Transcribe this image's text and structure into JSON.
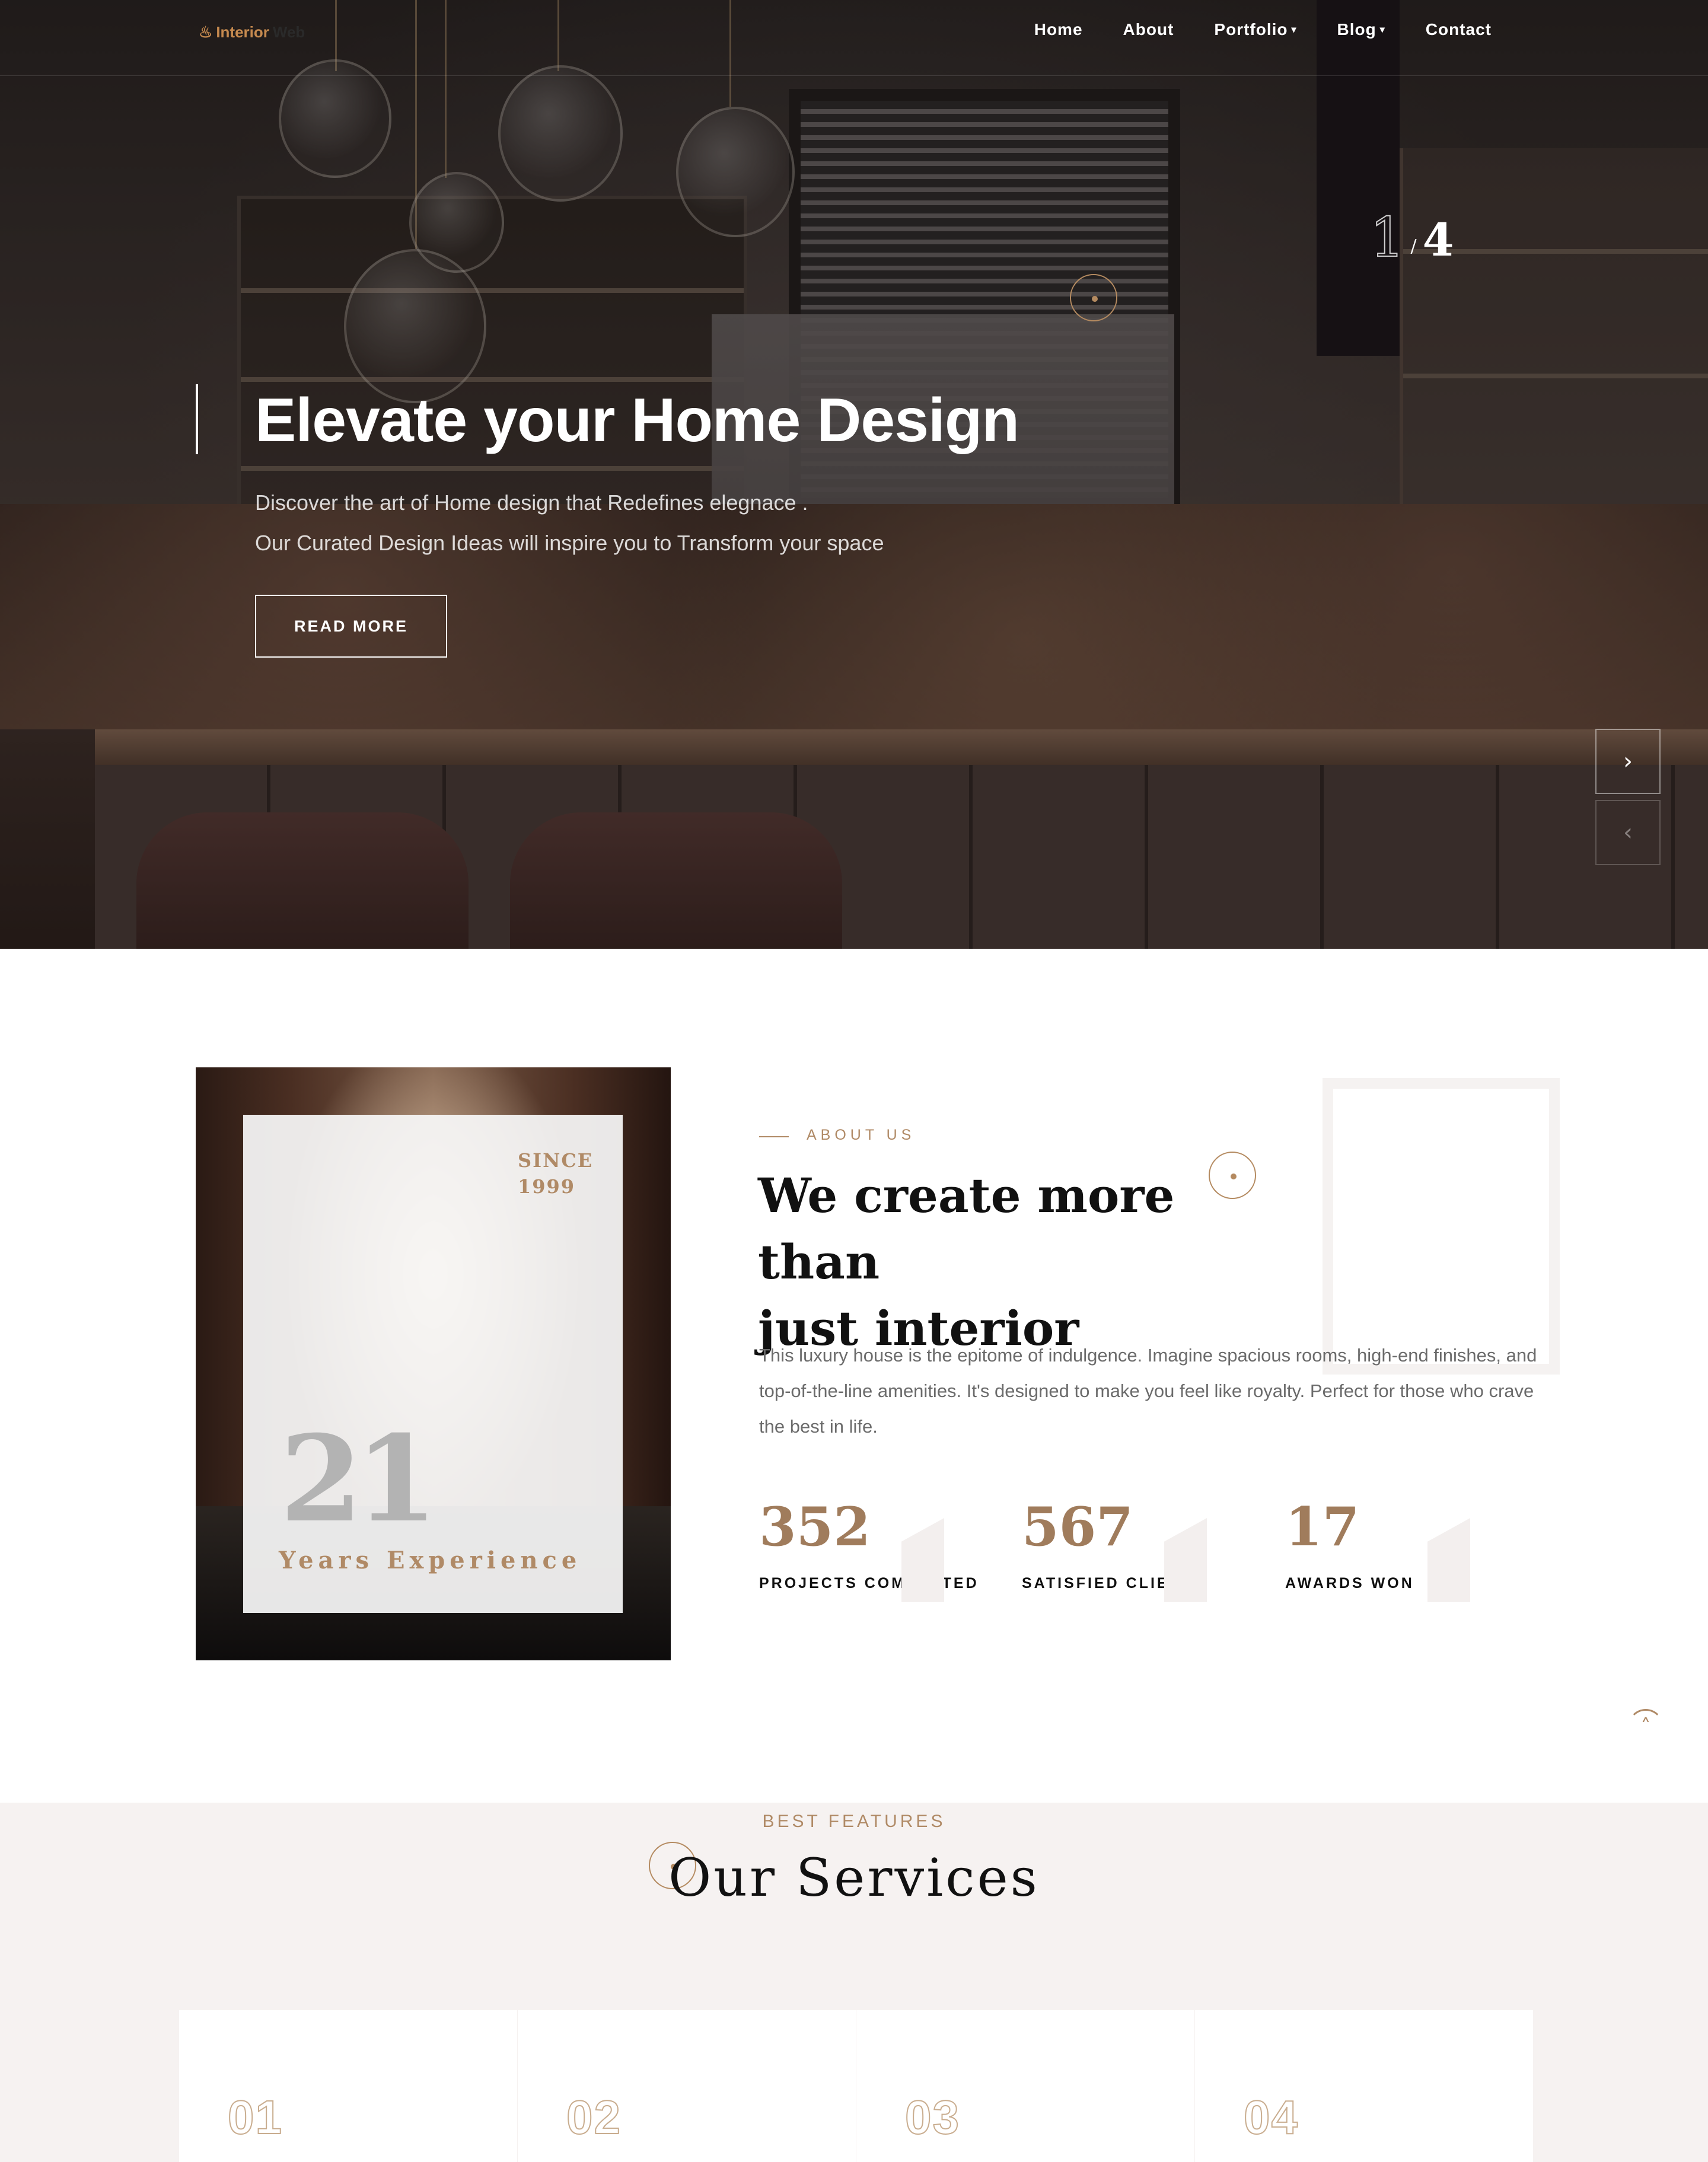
{
  "navbar": {
    "logo_part1": "Interior",
    "logo_part2": "Web",
    "items": [
      {
        "label": "Home",
        "dropdown": false
      },
      {
        "label": "About",
        "dropdown": false
      },
      {
        "label": "Portfolio",
        "dropdown": true
      },
      {
        "label": "Blog",
        "dropdown": true
      },
      {
        "label": "Contact",
        "dropdown": false
      }
    ]
  },
  "hero": {
    "slide_current": "1",
    "slide_separator": "/",
    "slide_total": "4",
    "title": "Elevate your Home Design",
    "subtitle_line1": "Discover the art of Home design that Redefines elegnace .",
    "subtitle_line2": "Our Curated Design Ideas will inspire you to Transform your space",
    "button": "READ MORE",
    "next_icon": "chevron-right-icon",
    "prev_icon": "chevron-left-icon"
  },
  "about": {
    "since_label": "SINCE",
    "since_year": "1999",
    "years_number": "21",
    "years_label": "Years Experience",
    "eyebrow": "ABOUT US",
    "title_line1": "We create more than",
    "title_line2": "just interior",
    "text": "This luxury house is the epitome of indulgence. Imagine spacious rooms, high-end finishes, and top-of-the-line amenities. It's designed to make you feel like royalty. Perfect for those who crave the best in life.",
    "stats": [
      {
        "value": "352",
        "label": "PROJECTS COMPLETED"
      },
      {
        "value": "567",
        "label": "SATISFIED CLIENTS"
      },
      {
        "value": "17",
        "label": "AWARDS WON"
      }
    ]
  },
  "services": {
    "eyebrow": "BEST FEATURES",
    "title": "Our Services",
    "cards": [
      {
        "index": "01"
      },
      {
        "index": "02"
      },
      {
        "index": "03"
      },
      {
        "index": "04"
      }
    ]
  },
  "colors": {
    "accent": "#b08a66",
    "logo_accent": "#c68a4f",
    "services_bg": "#f6f2f1"
  }
}
